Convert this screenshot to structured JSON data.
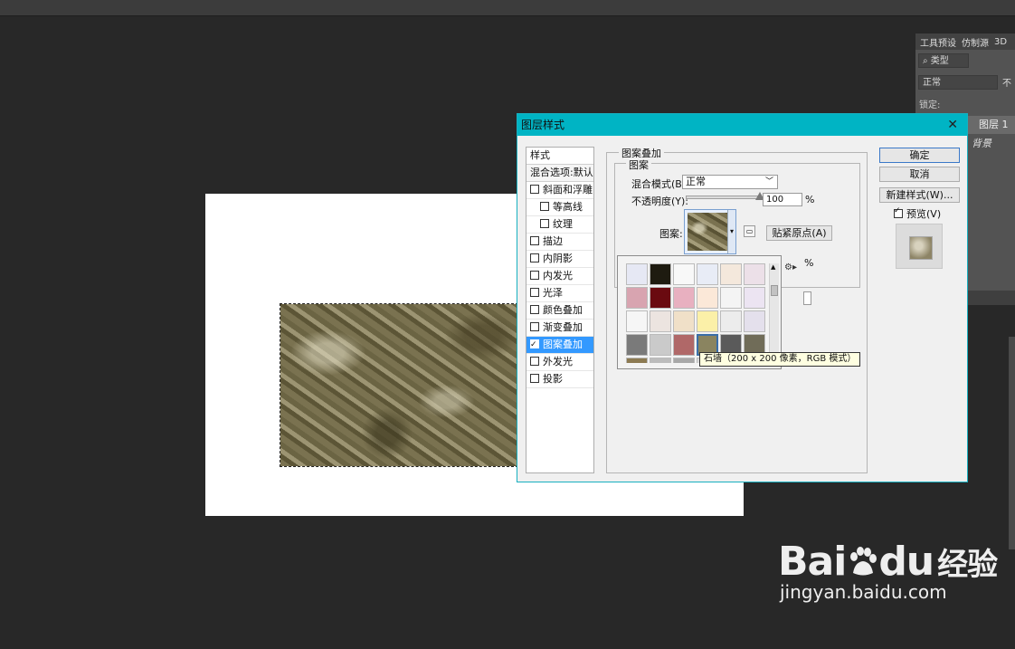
{
  "panels": {
    "tabs": [
      "工具预设",
      "仿制源",
      "3D"
    ],
    "filter_kind": "类型",
    "blend_mode": "正常",
    "opacity_label": "不",
    "lock_label": "锁定:",
    "layer_1": "图层 1",
    "layer_background": "背景"
  },
  "dialog": {
    "title": "图层样式",
    "close": "✕",
    "styles_header": "样式",
    "blend_options": "混合选项:默认",
    "style_items": [
      {
        "label": "斜面和浮雕",
        "checked": false,
        "sub": false
      },
      {
        "label": "等高线",
        "checked": false,
        "sub": true
      },
      {
        "label": "纹理",
        "checked": false,
        "sub": true
      },
      {
        "label": "描边",
        "checked": false,
        "sub": false
      },
      {
        "label": "内阴影",
        "checked": false,
        "sub": false
      },
      {
        "label": "内发光",
        "checked": false,
        "sub": false
      },
      {
        "label": "光泽",
        "checked": false,
        "sub": false
      },
      {
        "label": "颜色叠加",
        "checked": false,
        "sub": false
      },
      {
        "label": "渐变叠加",
        "checked": false,
        "sub": false
      },
      {
        "label": "图案叠加",
        "checked": true,
        "sub": false,
        "selected": true
      },
      {
        "label": "外发光",
        "checked": false,
        "sub": false
      },
      {
        "label": "投影",
        "checked": false,
        "sub": false
      }
    ],
    "section_title": "图案叠加",
    "group_title": "图案",
    "blend_mode_label": "混合模式(B):",
    "blend_mode_value": "正常",
    "opacity_label": "不透明度(Y):",
    "opacity_value": "100",
    "percent": "%",
    "pattern_label": "图案:",
    "snap_origin_button": "贴紧原点(A)",
    "ok_button": "确定",
    "cancel_button": "取消",
    "new_style_button": "新建样式(W)...",
    "preview_label": "预览(V)",
    "preview_checked": true,
    "tooltip": "石墙（200 x 200 像素，RGB 模式）",
    "swatch_colors": [
      "#e6e8f4",
      "#1e1b10",
      "#f8f8f8",
      "#e8ecf6",
      "#f4e8dc",
      "#ece0e8",
      "#d8a4b0",
      "#6a0a10",
      "#e8b0c0",
      "#fbe8d8",
      "#f4f4f4",
      "#ece4f2",
      "#f6f6f6",
      "#ece4e0",
      "#f0e0c8",
      "#fbf0a8",
      "#ececec",
      "#e4e0ec",
      "#7a7a7a",
      "#cacaca",
      "#b06868",
      "#8a8460",
      "#5a5a5a",
      "#706c58",
      "#8c7a52",
      "#bcbcbc",
      "#a8a8a8",
      "#dcdcdc",
      "#cfcfcf",
      "#e2e2e2"
    ],
    "highlighted_swatch": 21
  },
  "watermark": {
    "logo_left": "Bai",
    "logo_right": "du",
    "logo_cn": "经验",
    "url": "jingyan.baidu.com"
  }
}
